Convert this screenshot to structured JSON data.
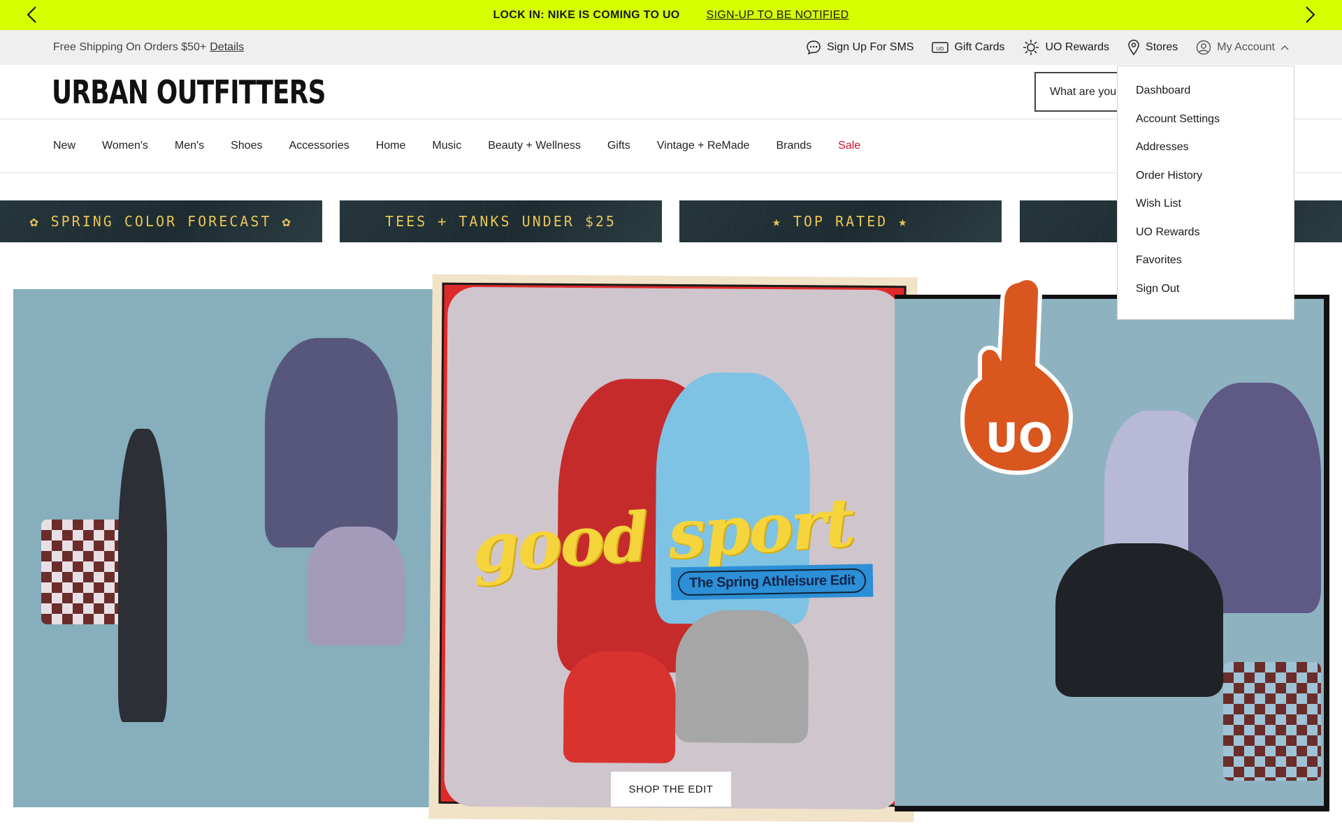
{
  "promo": {
    "message": "LOCK IN: NIKE IS COMING TO UO",
    "cta": "SIGN-UP TO BE NOTIFIED",
    "bg_color": "#d6ff00"
  },
  "utility": {
    "shipping_text": "Free Shipping On Orders $50+",
    "details_link": "Details",
    "links": [
      {
        "label": "Sign Up For SMS",
        "icon": "chat-bubble-icon"
      },
      {
        "label": "Gift Cards",
        "icon": "gift-card-icon"
      },
      {
        "label": "UO Rewards",
        "icon": "sun-icon"
      },
      {
        "label": "Stores",
        "icon": "map-pin-icon"
      },
      {
        "label": "My Account",
        "icon": "user-circle-icon"
      }
    ]
  },
  "header": {
    "logo": "URBAN OUTFITTERS",
    "search_placeholder": "What are you"
  },
  "nav": {
    "items": [
      "New",
      "Women's",
      "Men's",
      "Shoes",
      "Accessories",
      "Home",
      "Music",
      "Beauty + Wellness",
      "Gifts",
      "Vintage + ReMade",
      "Brands",
      "Sale"
    ],
    "sale_color": "#c8102e"
  },
  "tiles": [
    "✿ SPRING COLOR FORECAST ✿",
    "TEES + TANKS UNDER $25",
    "★ TOP RATED ★",
    ""
  ],
  "hero": {
    "headline": "good sport",
    "badge": "The Spring Athleisure Edit",
    "cta": "SHOP THE EDIT",
    "foam_finger_text": "UO"
  },
  "account_menu": {
    "items": [
      "Dashboard",
      "Account Settings",
      "Addresses",
      "Order History",
      "Wish List",
      "UO Rewards",
      "Favorites",
      "Sign Out"
    ]
  }
}
